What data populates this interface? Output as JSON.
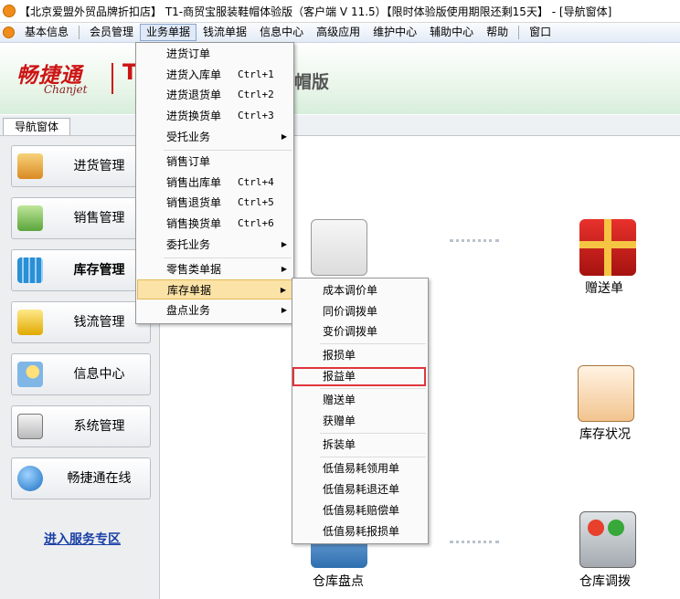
{
  "window": {
    "title": "【北京爱盟外贸品牌折扣店】 T1-商贸宝服装鞋帽体验版（客户端 V 11.5）【限时体验版使用期限还剩15天】 - [导航窗体]"
  },
  "menubar": {
    "items": [
      "基本信息",
      "会员管理",
      "业务单据",
      "钱流单据",
      "信息中心",
      "高级应用",
      "维护中心",
      "辅助中心",
      "帮助",
      "窗口"
    ]
  },
  "banner": {
    "brand_cn": "畅捷通",
    "brand_en": "Chanjet",
    "prefix": "T",
    "edition_suffix": "帽版"
  },
  "tabs": {
    "nav": "导航窗体"
  },
  "sidebar": {
    "items": [
      "进货管理",
      "销售管理",
      "库存管理",
      "钱流管理",
      "信息中心",
      "系统管理",
      "畅捷通在线"
    ],
    "active": "库存管理",
    "service_link": "进入服务专区"
  },
  "main": {
    "icons": [
      "赠送单",
      "库存状况",
      "仓库盘点",
      "仓库调拨"
    ]
  },
  "menu_business": {
    "items": [
      {
        "label": "进货订单",
        "shortcut": "",
        "arrow": false
      },
      {
        "label": "进货入库单",
        "shortcut": "Ctrl+1",
        "arrow": false
      },
      {
        "label": "进货退货单",
        "shortcut": "Ctrl+2",
        "arrow": false
      },
      {
        "label": "进货换货单",
        "shortcut": "Ctrl+3",
        "arrow": false
      },
      {
        "label": "受托业务",
        "shortcut": "",
        "arrow": true
      },
      {
        "label": "销售订单",
        "shortcut": "",
        "arrow": false
      },
      {
        "label": "销售出库单",
        "shortcut": "Ctrl+4",
        "arrow": false
      },
      {
        "label": "销售退货单",
        "shortcut": "Ctrl+5",
        "arrow": false
      },
      {
        "label": "销售换货单",
        "shortcut": "Ctrl+6",
        "arrow": false
      },
      {
        "label": "委托业务",
        "shortcut": "",
        "arrow": true
      },
      {
        "label": "零售类单据",
        "shortcut": "",
        "arrow": true
      },
      {
        "label": "库存单据",
        "shortcut": "",
        "arrow": true
      },
      {
        "label": "盘点业务",
        "shortcut": "",
        "arrow": true
      }
    ],
    "highlighted": "库存单据",
    "arrow_glyph": "▶"
  },
  "menu_inventory": {
    "items": [
      "成本调价单",
      "同价调拨单",
      "变价调拨单",
      "报损单",
      "报益单",
      "赠送单",
      "获赠单",
      "拆装单",
      "低值易耗领用单",
      "低值易耗退还单",
      "低值易耗赔偿单",
      "低值易耗报损单"
    ],
    "selected": "报益单"
  },
  "colors": {
    "brand_red": "#cc1414",
    "menu_highlight": "#fbe2a6",
    "selection_outline": "#e0353d",
    "link_blue": "#1a3fa6"
  }
}
